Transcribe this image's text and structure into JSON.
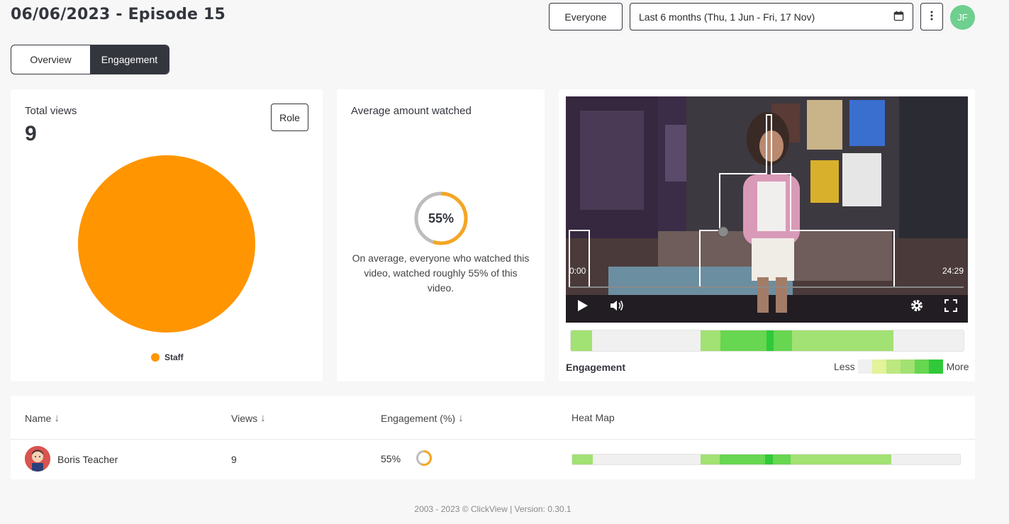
{
  "header": {
    "title": "06/06/2023 - Episode 15",
    "audience_button": "Everyone",
    "date_range": "Last 6 months (Thu, 1 Jun - Fri, 17 Nov)",
    "calendar_icon": "calendar-icon",
    "menu_icon": "kebab-menu-icon",
    "user_initials": "JF"
  },
  "tabs": [
    {
      "label": "Overview",
      "active": false
    },
    {
      "label": "Engagement",
      "active": true
    }
  ],
  "total_views": {
    "title": "Total views",
    "value": "9",
    "filter_button": "Role",
    "legend": [
      {
        "label": "Staff",
        "color": "#ff9500"
      }
    ]
  },
  "average_watched": {
    "title": "Average amount watched",
    "percent_label": "55%",
    "percent_value": 55,
    "description": "On average, everyone who watched this video, watched roughly 55% of this video.",
    "ring_color": "#f5a623",
    "track_color": "#bdbdbd"
  },
  "video": {
    "time_start": "0:00",
    "time_end": "24:29",
    "play_icon": "play-icon",
    "volume_icon": "volume-icon",
    "settings_icon": "gear-icon",
    "fullscreen_icon": "fullscreen-icon"
  },
  "engagement": {
    "label": "Engagement",
    "less_label": "Less",
    "more_label": "More",
    "scale_colors": [
      "#f0f0f0",
      "#e2f39a",
      "#bde77f",
      "#a2e173",
      "#67d651",
      "#2fc93a"
    ]
  },
  "table": {
    "columns": [
      "Name",
      "Views",
      "Engagement (%)",
      "Heat Map"
    ],
    "rows": [
      {
        "name": "Boris Teacher",
        "views": "9",
        "engagement": "55%",
        "engagement_value": 55
      }
    ]
  },
  "footer": "2003 - 2023 © ClickView | Version: 0.30.1"
}
